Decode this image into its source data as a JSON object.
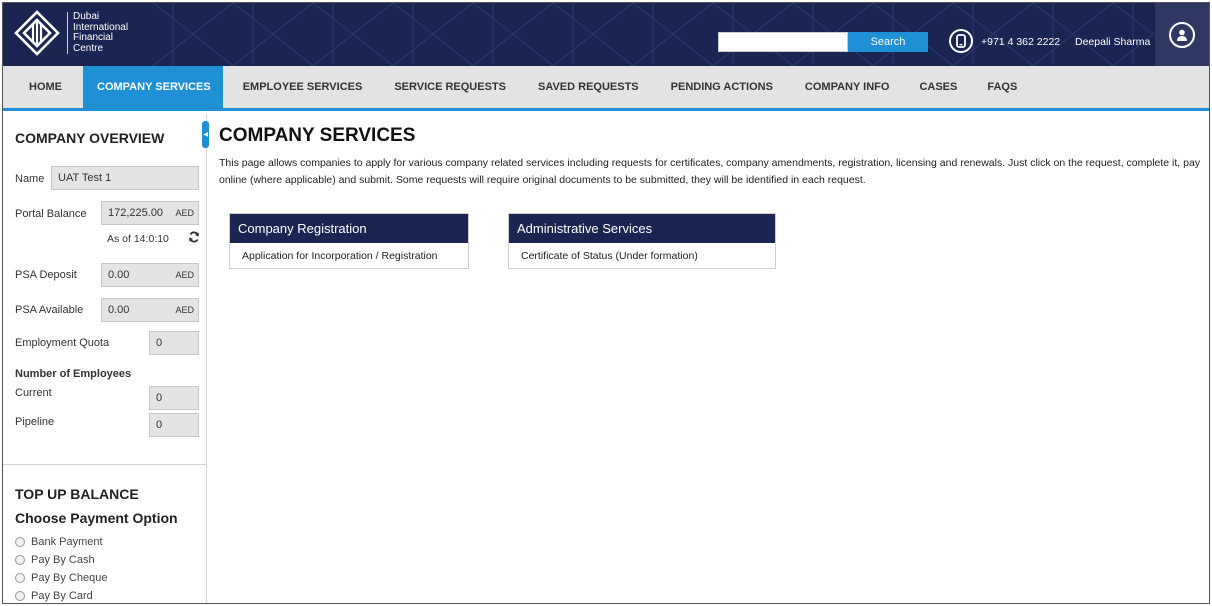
{
  "header": {
    "logo_lines": [
      "Dubai",
      "International",
      "Financial",
      "Centre"
    ],
    "search_placeholder": "",
    "search_button": "Search",
    "phone": "+971 4 362 2222",
    "user_name": "Deepali Sharma",
    "icons": [
      "phone-icon",
      "user-icon"
    ]
  },
  "nav": {
    "items": [
      {
        "label": "HOME",
        "active": false
      },
      {
        "label": "COMPANY SERVICES",
        "active": true
      },
      {
        "label": "EMPLOYEE SERVICES",
        "active": false
      },
      {
        "label": "SERVICE REQUESTS",
        "active": false
      },
      {
        "label": "SAVED REQUESTS",
        "active": false
      },
      {
        "label": "PENDING ACTIONS",
        "active": false
      },
      {
        "label": "COMPANY INFO",
        "active": false
      },
      {
        "label": "CASES",
        "active": false
      },
      {
        "label": "FAQS",
        "active": false
      }
    ]
  },
  "sidebar": {
    "title": "COMPANY OVERVIEW",
    "name_label": "Name",
    "name_value": "UAT Test 1",
    "portal_balance_label": "Portal Balance",
    "portal_balance_value": "172,225.00",
    "portal_balance_unit": "AED",
    "as_of": "As of 14:0:10",
    "psa_deposit_label": "PSA Deposit",
    "psa_deposit_value": "0.00",
    "psa_deposit_unit": "AED",
    "psa_available_label": "PSA Available",
    "psa_available_value": "0.00",
    "psa_available_unit": "AED",
    "employment_quota_label": "Employment Quota",
    "employment_quota_value": "0",
    "employees_heading": "Number of Employees",
    "current_label": "Current",
    "current_value": "0",
    "pipeline_label": "Pipeline",
    "pipeline_value": "0",
    "topup_title": "TOP UP BALANCE",
    "payment_title": "Choose Payment Option",
    "payment_options": [
      "Bank Payment",
      "Pay By Cash",
      "Pay By Cheque",
      "Pay By Card"
    ]
  },
  "main": {
    "title": "COMPANY SERVICES",
    "description": "This page allows companies to apply for various company related services including requests for certificates, company amendments, registration, licensing and renewals. Just click on the request, complete it, pay online (where applicable) and submit. Some requests will require original documents to be submitted, they will be identified in each request.",
    "cards": [
      {
        "title": "Company Registration",
        "items": [
          "Application for Incorporation / Registration"
        ]
      },
      {
        "title": "Administrative Services",
        "items": [
          "Certificate of Status (Under formation)"
        ]
      }
    ]
  },
  "colors": {
    "navy": "#1b2552",
    "accent_blue": "#1f8fd6",
    "nav_bg": "#e2e3e5"
  }
}
